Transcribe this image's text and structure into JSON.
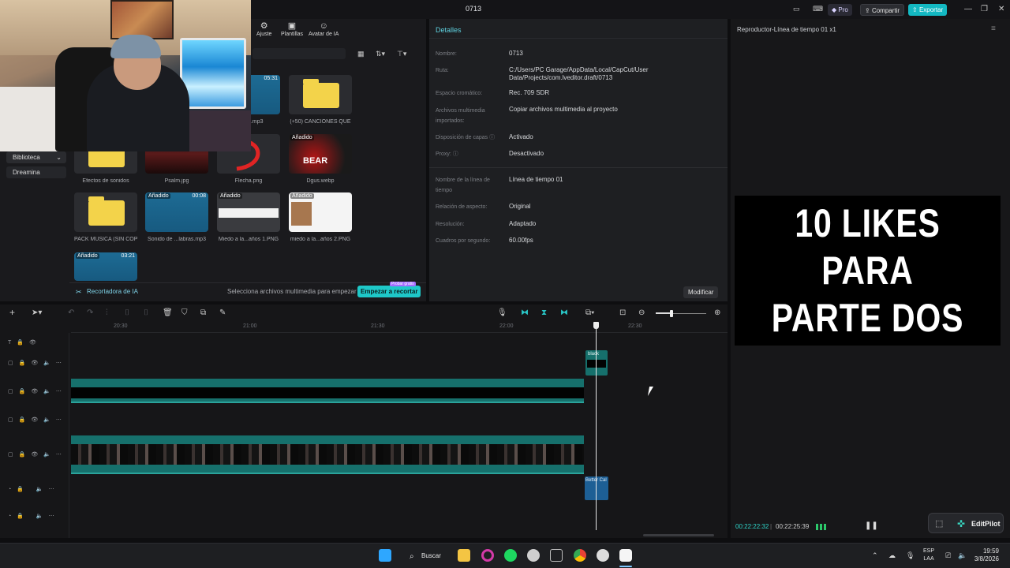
{
  "app": {
    "title": "0713"
  },
  "topbar": {
    "pro": "Pro",
    "share": "Compartir",
    "export": "Exportar"
  },
  "media_panel": {
    "tabs": [
      "Ajuste",
      "Plantillas",
      "Avatar de IA"
    ],
    "sidebar": [
      "Biblioteca",
      "Dreamina"
    ],
    "items": [
      {
        "caption": "[CaKe].mp3",
        "duration": "05:31",
        "kind": "audio"
      },
      {
        "caption": "(+50) CANCIONES QUE",
        "kind": "folder"
      },
      {
        "caption": "Efectos de sonidos",
        "kind": "folder"
      },
      {
        "caption": "Psalm.jpg",
        "kind": "image"
      },
      {
        "caption": "Flecha.png",
        "kind": "image"
      },
      {
        "caption": "Dgus.webp",
        "tag": "Añadido",
        "kind": "image"
      },
      {
        "caption": "PACK MUSICA (SIN COP",
        "kind": "folder"
      },
      {
        "caption": "Sonido de ...labras.mp3",
        "tag": "Añadido",
        "duration": "00:08",
        "kind": "audio"
      },
      {
        "caption": "Miedo a la...años 1.PNG",
        "tag": "Añadido",
        "kind": "image"
      },
      {
        "caption": "miedo a la...años 2.PNG",
        "tag": "Añadido",
        "kind": "image"
      },
      {
        "caption": "",
        "tag": "Añadido",
        "duration": "03:21",
        "kind": "audio"
      }
    ],
    "cutter": {
      "label": "Recortadora de IA",
      "hint": "Selecciona archivos multimedia para empezar",
      "button": "Empezar a recortar",
      "badge": "Probar gratis"
    }
  },
  "details": {
    "title": "Detalles",
    "fields": [
      {
        "label": "Nombre:",
        "value": "0713"
      },
      {
        "label": "Ruta:",
        "value": "C:/Users/PC Garage/AppData/Local/CapCut/User Data/Projects/com.lveditor.draft/0713"
      },
      {
        "label": "Espacio cromático:",
        "value": "Rec. 709 SDR"
      },
      {
        "label": "Archivos multimedia importados:",
        "value": "Copiar archivos multimedia al proyecto"
      },
      {
        "label": "Disposición de capas",
        "value": "Activado"
      },
      {
        "label": "Proxy:",
        "value": "Desactivado"
      },
      {
        "label": "Nombre de la línea de tiempo",
        "value": "Línea de tiempo 01"
      },
      {
        "label": "Relación de aspecto:",
        "value": "Original"
      },
      {
        "label": "Resolución:",
        "value": "Adaptado"
      },
      {
        "label": "Cuadros por segundo:",
        "value": "60.00fps"
      }
    ],
    "modify": "Modificar"
  },
  "player": {
    "title": "Reproductor-Línea de tiempo 01 x1",
    "preview_line1": "10 LIKES PARA",
    "preview_line2": "PARTE DOS",
    "time_current": "00:22:22:32",
    "time_separator": "|",
    "time_total": "00:22:25:39",
    "plugin": "EditPilot"
  },
  "timeline": {
    "ticks": [
      "20:30",
      "21:00",
      "21:30",
      "22:00",
      "22:30"
    ],
    "clips": {
      "black": "black",
      "audio": "Better Cal"
    }
  },
  "taskbar": {
    "search": "Buscar",
    "lang1": "ESP",
    "lang2": "LAA",
    "time": "19:59",
    "date": "3/8/2026"
  },
  "colors": {
    "accent": "#13b8c2",
    "track": "#16706c",
    "audio_clip": "#1d5f95"
  }
}
